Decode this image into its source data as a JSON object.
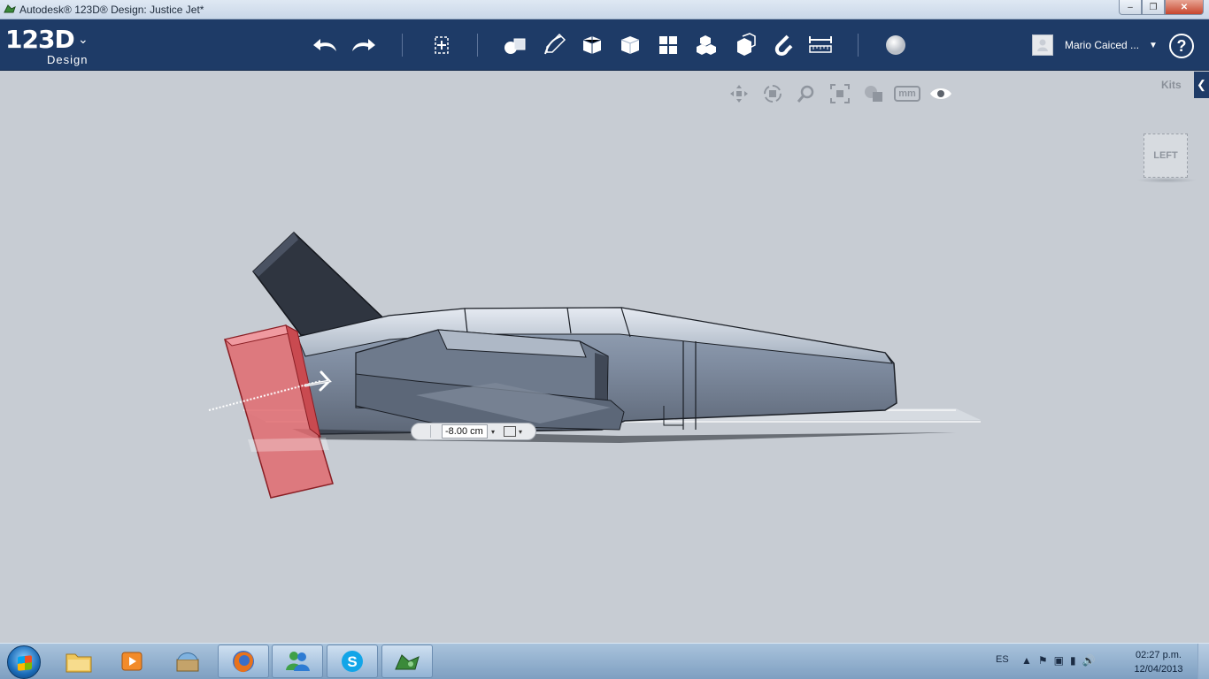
{
  "window": {
    "title": "Autodesk® 123D® Design: Justice Jet*",
    "minimize_label": "–",
    "maximize_label": "❐",
    "close_label": "✕"
  },
  "toolbar": {
    "logo_text": "123D",
    "logo_sub": "Design",
    "logo_menu_glyph": "⌄",
    "tools": [
      "undo-icon",
      "redo-icon",
      "transform-icon",
      "primitives-icon",
      "sketch-icon",
      "construct-icon",
      "modify-icon",
      "pattern-icon",
      "grouping-icon",
      "combine-icon",
      "snap-icon",
      "measure-icon",
      "material-icon"
    ],
    "user_name": "Mario Caiced ...",
    "user_caret": "▼",
    "help_label": "?"
  },
  "viewport": {
    "nav_tools": [
      "pan-icon",
      "orbit-icon",
      "zoom-icon",
      "fit-icon",
      "visual-style-icon",
      "units-icon",
      "visibility-icon"
    ],
    "units_label": "mm",
    "kits_label": "Kits",
    "kits_tab_glyph": "❮",
    "viewcube_label": "LEFT",
    "dimension_value": "-8.00 cm",
    "dimension_caret": "▾"
  },
  "taskbar": {
    "items": [
      "file-explorer-icon",
      "media-player-icon",
      "archive-icon",
      "firefox-icon",
      "messenger-icon",
      "skype-icon",
      "123d-design-icon"
    ],
    "language": "ES",
    "tray_glyphs": [
      "▲",
      "⚑",
      "▣",
      "▮",
      "🔊"
    ],
    "time": "02:27 p.m.",
    "date": "12/04/2013"
  },
  "colors": {
    "toolbar_bg": "#1e3b67",
    "viewport_bg": "#c7ccd3",
    "selected_part": "#e06a6f"
  }
}
